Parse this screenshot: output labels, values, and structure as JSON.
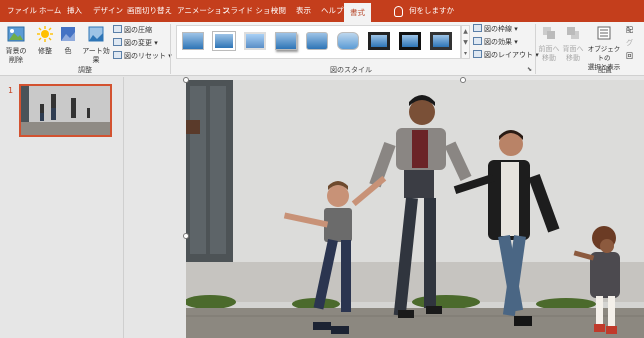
{
  "tabs": [
    "ファイル",
    "ホーム",
    "挿入",
    "デザイン",
    "画面切り替え",
    "アニメーション",
    "スライド ショー",
    "校閲",
    "表示",
    "ヘルプ",
    "書式"
  ],
  "active_tab": "書式",
  "tell_me": "何をしますか",
  "ribbon": {
    "adjust": {
      "remove_bg": "背景の\n削除",
      "corrections": "修整",
      "color": "色",
      "artistic": "アート効果",
      "compress": "図の圧縮",
      "change": "図の変更",
      "reset": "図のリセット",
      "label": "調整"
    },
    "styles": {
      "label": "図のスタイル",
      "border": "図の枠線",
      "effects": "図の効果",
      "layout": "図のレイアウト"
    },
    "arrange": {
      "bring_forward": "前面へ\n移動",
      "send_backward": "背面へ\n移動",
      "selection_pane": "オブジェクトの\n選択と表示",
      "label": "配置",
      "align": "配",
      "group": "グ",
      "rotate": "回"
    }
  },
  "slides": {
    "current_number": "1"
  },
  "colors": {
    "accent": "#c43e1c",
    "ribbon_bg": "#f3f3f3",
    "pane_bg": "#e6e6e6",
    "thumb_border": "#d35230"
  },
  "icons": {
    "tell_me": "lightbulb-icon",
    "remove_bg": "remove-background-icon",
    "corrections": "sun-icon",
    "color": "color-icon",
    "artistic": "artistic-effects-icon"
  }
}
